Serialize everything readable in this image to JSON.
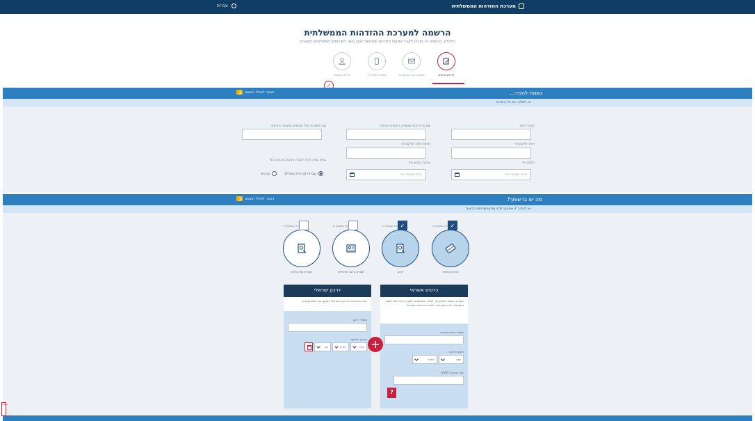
{
  "header": {
    "brand_label": "מערכת ההזדהות הממשלתית",
    "language_label": "עברית"
  },
  "page": {
    "title": "הרשמה למערכת ההזדהות הממשלתית",
    "subtitle": "בתהליך הרשמה זה תוכלו לקבל אמצעי הזדהות שיאפשר לכם גישה לשירותים ממשלתיים מקוונים"
  },
  "steps": [
    {
      "label": "פרטים אישיים",
      "icon": "form-edit-icon",
      "active": true
    },
    {
      "label": "אימות דואר אלקטרוני",
      "icon": "email-icon",
      "active": false
    },
    {
      "label": "אימות טלפון נייד",
      "icon": "mobile-phone-icon",
      "active": false
    },
    {
      "label": "יצירת משתמש",
      "icon": "user-icon",
      "active": false
    }
  ],
  "section1": {
    "title": "נשמח להכיר...",
    "guide_label": "הסבר למילוי הטופס",
    "note": "נא למלא את כל השדות",
    "fields": {
      "id_label": "מספר זהות",
      "first_name_label": "שם פרטי (כפי שמופיע בתעודת הזהות)",
      "last_name_label": "שם משפחה (כפי שמופיע בתעודת הזהות)",
      "email_label": "דואר אלקטרוני",
      "email_confirm_label": "אימות דואר אלקטרוני",
      "mobile_label": "טלפון נייד",
      "mobile_placeholder": "הזינו מספר נייד",
      "mobile_confirm_label": "אימות טלפון נייד",
      "mobile_confirm_placeholder": "הזינו מספר נייד",
      "language_question": "באיזו שפה תרצו לקבל הודעות מהמערכת?",
      "radio_hebrew": "עברית (ברירת מחדל)",
      "radio_arabic": "ערבית"
    }
  },
  "section2": {
    "title": "מה יש ברשותך?",
    "guide_label": "הסבר למילוי הטופס",
    "note": "יש לבחור 2 אמצעי זיהוי מהאפשרויות הבאות",
    "docs": [
      {
        "label": "כרטיס אשראי",
        "select_text": "בחרו אמצעי זה",
        "icon": "credit-card-icon",
        "checked": true
      },
      {
        "label": "דרכון",
        "select_text": "בחרו אמצעי זה",
        "icon": "passport-icon",
        "checked": true
      },
      {
        "label": "תעודת נהיגה ישראלית",
        "select_text": "בחרו אמצעי זה",
        "icon": "driving-license-icon",
        "checked": false
      },
      {
        "label": "תעודת עולה חדש",
        "select_text": "בחרו אמצעי זה",
        "icon": "immigrant-certificate-icon",
        "checked": false
      }
    ]
  },
  "credit_card": {
    "title": "כרטיס אשראי",
    "note": "המידע הנמסר יימחק מיד לאחר השימוש בו לצורך הזיהוי ולא יישמר במערכת. לא יבוצע חיוב כלשהו בכרטיס האשראי",
    "number_label": "מספר כרטיס אשראי",
    "expiry_label": "תוקף כרטיס",
    "year": "שנה",
    "month": "חודש",
    "cvv_label": "קוד אבטחה (CVV)",
    "help": "?"
  },
  "passport": {
    "title": "דרכון ישראלי",
    "note": "הזינו את פרטי הדרכון הישראלי בתוקף כפי שמופיעים בו",
    "number_label": "מספר דרכון",
    "issue_label": "תאריך הנפקה",
    "year": "שנה",
    "month": "חודש",
    "day": "יום"
  },
  "add_button": "+",
  "side_tab": "נגישות",
  "colors": {
    "navy": "#0f3d66",
    "accent_red": "#c8203d",
    "section_blue": "#2e7fbf",
    "light_blue": "#d3e6f5"
  }
}
